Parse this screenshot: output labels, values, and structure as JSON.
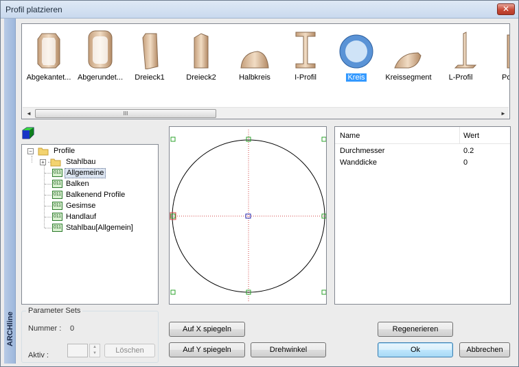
{
  "window": {
    "title": "Profil platzieren",
    "close_glyph": "✕",
    "brand": "ARCHline"
  },
  "gallery": {
    "items": [
      {
        "label": "Abgekantet...",
        "icon": "beveled-profile-icon"
      },
      {
        "label": "Abgerundet...",
        "icon": "rounded-profile-icon"
      },
      {
        "label": "Dreieck1",
        "icon": "triangle1-profile-icon"
      },
      {
        "label": "Dreieck2",
        "icon": "triangle2-profile-icon"
      },
      {
        "label": "Halbkreis",
        "icon": "halfcircle-profile-icon"
      },
      {
        "label": "I-Profil",
        "icon": "i-beam-profile-icon"
      },
      {
        "label": "Kreis",
        "icon": "circle-profile-icon",
        "selected": true
      },
      {
        "label": "Kreissegment",
        "icon": "circle-segment-profile-icon"
      },
      {
        "label": "L-Profil",
        "icon": "l-profile-icon"
      },
      {
        "label": "Pol",
        "icon": "polygon-profile-icon"
      }
    ],
    "scroll_left": "◄",
    "scroll_right": "►",
    "thumb_grip": "III"
  },
  "tree": {
    "root": "Profile",
    "collapsed_child": "Stahlbau",
    "items": [
      "Allgemeine",
      "Balken",
      "Balkenend Profile",
      "Gesimse",
      "Handlauf",
      "Stahlbau[Allgemein]"
    ],
    "selected": "Allgemeine",
    "expand_minus": "−",
    "expand_plus": "+",
    "leaf_badge": "011"
  },
  "parameter_sets": {
    "legend": "Parameter Sets",
    "nummer_label": "Nummer :",
    "nummer_value": "0",
    "aktiv_label": "Aktiv :",
    "loeschen": "Löschen",
    "spin_up": "▲",
    "spin_down": "▼"
  },
  "properties": {
    "col_name": "Name",
    "col_value": "Wert",
    "rows": [
      {
        "name": "Durchmesser",
        "value": "0.2"
      },
      {
        "name": "Wanddicke",
        "value": "0"
      }
    ]
  },
  "buttons": {
    "mirror_x": "Auf X spiegeln",
    "mirror_y": "Auf Y spiegeln",
    "rotation": "Drehwinkel",
    "regenerate": "Regenerieren",
    "ok": "Ok",
    "cancel": "Abbrechen"
  }
}
